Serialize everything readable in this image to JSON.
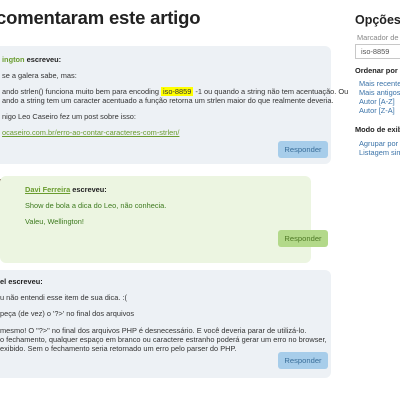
{
  "page": {
    "heading": "comentaram este artigo"
  },
  "comments": [
    {
      "author_name": "ington",
      "author_suffix": " escreveu:",
      "lines": [
        "se a galera sabe, mas:",
        "ando strlen() funciona muito bem para encoding ",
        "ando a string tem um caracter acentuado a função retorna um strlen maior do que realmente deveria.",
        "nigo Leo Caseiro fez um post sobre isso:"
      ],
      "highlight": "iso-8859",
      "line2_tail": " -1 ou quando a string não tem acentuação. Ou",
      "link": "ocaseiro.com.br/erro-ao-contar-caracteres-com-strlen/",
      "reply_label": "Responder"
    },
    {
      "author_name": "Davi Ferreira",
      "author_suffix": " escreveu:",
      "lines": [
        "Show de bola a dica do Leo, não conhecia.",
        "Valeu, Wellington!"
      ],
      "reply_label": "Responder"
    },
    {
      "author_name": "el escreveu:",
      "lines": [
        "u não entendi esse item de sua dica. :(",
        "peça (de vez) o '?>' no final dos arquivos",
        "mesmo! O \"?>\" no final dos arquivos PHP é desnecessário. E você deveria parar de utilizá-lo.",
        "o fechamento, qualquer espaço em branco ou caractere estranho poderá gerar um erro no browser,",
        "exibido. Sem o fechamento seria retornado um erro pelo parser do PHP."
      ],
      "reply_label": "Responder"
    }
  ],
  "sidebar": {
    "title": "Opções",
    "marker_label": "Marcador de te",
    "search_value": "iso-8859",
    "order_label": "Ordenar por",
    "order_options": [
      "Mais recente",
      "Mais antigos",
      "Autor [A-Z]",
      "Autor [Z-A]"
    ],
    "display_label": "Modo de exib",
    "display_options": [
      "Agrupar por",
      "Listagem sim"
    ]
  },
  "colors": {
    "comment_blue_bg": "#edf1f5",
    "comment_green_bg": "#ecf5e1",
    "accent_green": "#6a9c2f",
    "reply_blue": "#a7cdea",
    "reply_green": "#b3d98a",
    "highlight": "#ffff00",
    "link_blue": "#3b73a8"
  }
}
